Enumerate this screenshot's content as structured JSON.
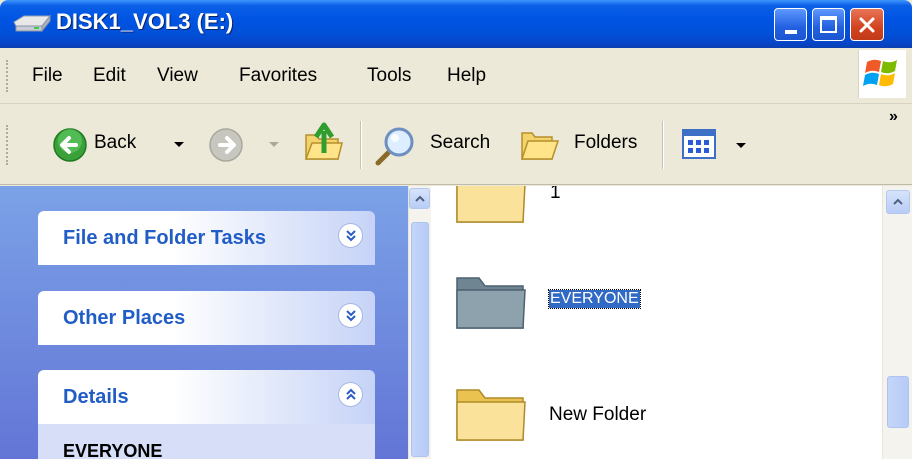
{
  "window": {
    "title": "DISK1_VOL3 (E:)",
    "colors": {
      "titlebar": "#0054e3",
      "close_button": "#d2431f",
      "taskpane": "#7ba2e7",
      "selection": "#316ac5"
    }
  },
  "menu": {
    "items": [
      "File",
      "Edit",
      "View",
      "Favorites",
      "Tools",
      "Help"
    ]
  },
  "toolbar": {
    "back_label": "Back",
    "search_label": "Search",
    "folders_label": "Folders",
    "overflow": "»"
  },
  "taskpane": {
    "groups": [
      {
        "title": "File and Folder Tasks",
        "state": "collapsed"
      },
      {
        "title": "Other Places",
        "state": "collapsed"
      },
      {
        "title": "Details",
        "state": "expanded"
      }
    ],
    "details_name": "EVERYONE"
  },
  "files": [
    {
      "name": "1",
      "icon": "folder-icon",
      "selected": false
    },
    {
      "name": "EVERYONE",
      "icon": "folder-icon",
      "selected": true,
      "tint": "gray"
    },
    {
      "name": "New Folder",
      "icon": "folder-icon",
      "selected": false
    }
  ]
}
